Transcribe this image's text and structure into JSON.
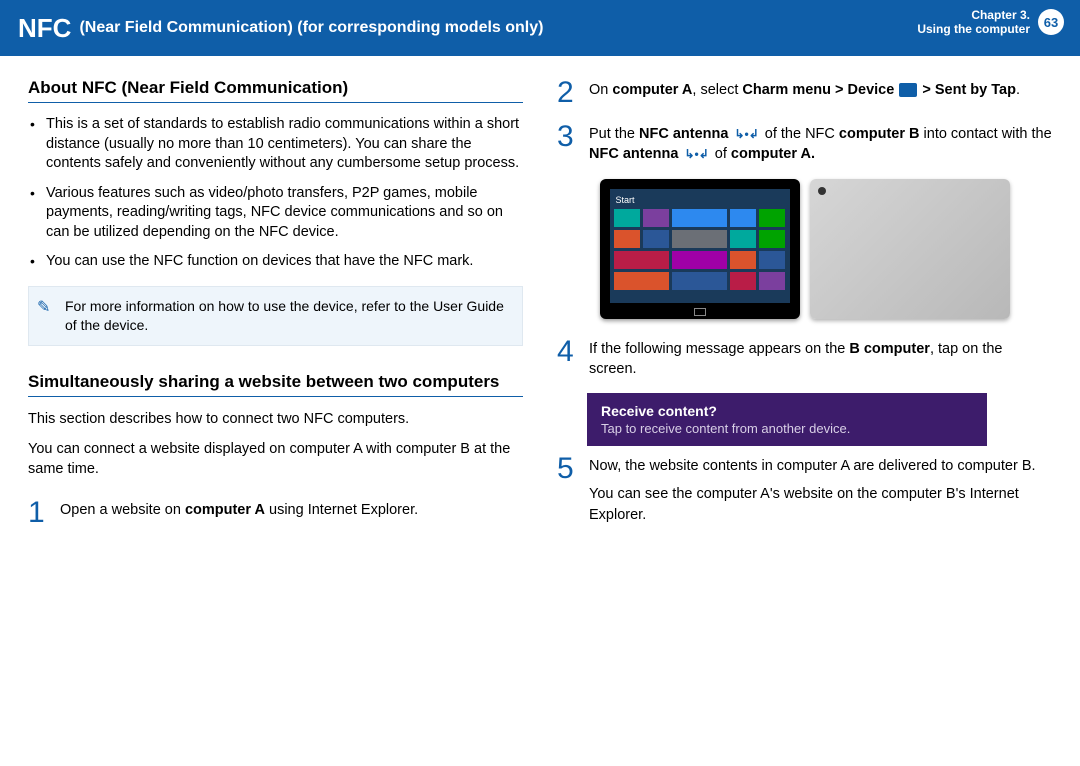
{
  "header": {
    "title_big": "NFC",
    "title_rest": "(Near Field Communication) (for corresponding models only)",
    "chapter_line1": "Chapter 3.",
    "chapter_line2": "Using the computer",
    "page_number": "63"
  },
  "left": {
    "h_about": "About NFC (Near Field Communication)",
    "bullets": [
      "This is a set of standards to establish radio communications within a short distance (usually no more than 10 centimeters). You can share the contents safely and conveniently without any cumbersome setup process.",
      "Various features such as video/photo transfers, P2P games, mobile payments, reading/writing tags, NFC device communications and so on can be utilized depending on the NFC device.",
      "You can use the NFC function on devices that have the NFC mark."
    ],
    "note": "For more information on how to use the device, refer to the User Guide of the device.",
    "h_share": "Simultaneously sharing a website between two computers",
    "share_p1": "This section describes how to connect two NFC computers.",
    "share_p2": "You can connect a website displayed on computer A with computer B at the same time.",
    "step1_pre": "Open a website on ",
    "step1_bold": "computer A",
    "step1_post": " using Internet Explorer."
  },
  "right": {
    "step2_a": "On ",
    "step2_b": "computer A",
    "step2_c": ", select ",
    "step2_d": "Charm menu > Device ",
    "step2_e": " > Sent by Tap",
    "step2_f": ".",
    "step3_a": "Put the ",
    "step3_b": "NFC antenna ",
    "step3_c": " of the NFC ",
    "step3_d": "computer B",
    "step3_e": " into contact with the ",
    "step3_f": "NFC antenna ",
    "step3_g": " of ",
    "step3_h": "computer A.",
    "tablet_start": "Start",
    "step4_a": "If the following message appears on the ",
    "step4_b": "B computer",
    "step4_c": ", tap on the screen.",
    "receive_title": "Receive content?",
    "receive_sub": "Tap to receive content from another device.",
    "step5_p1": "Now, the website contents in computer A are delivered to computer B.",
    "step5_p2": "You can see the computer A's website on the computer B's Internet Explorer."
  },
  "nums": {
    "n1": "1",
    "n2": "2",
    "n3": "3",
    "n4": "4",
    "n5": "5"
  },
  "icons": {
    "nfc_glyph": "↳•↲"
  }
}
